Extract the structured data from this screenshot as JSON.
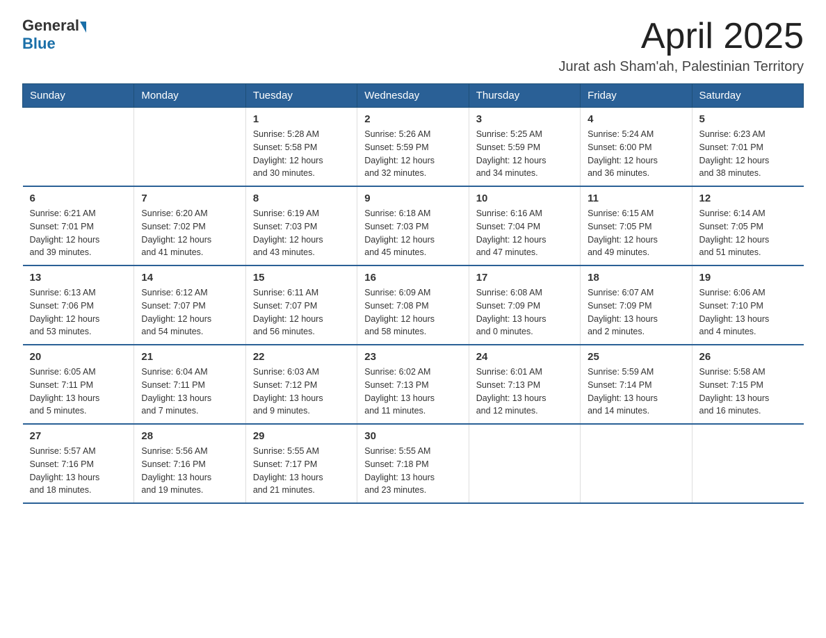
{
  "logo": {
    "general": "General",
    "blue": "Blue"
  },
  "header": {
    "month": "April 2025",
    "location": "Jurat ash Sham'ah, Palestinian Territory"
  },
  "weekdays": [
    "Sunday",
    "Monday",
    "Tuesday",
    "Wednesday",
    "Thursday",
    "Friday",
    "Saturday"
  ],
  "weeks": [
    [
      {
        "day": "",
        "info": ""
      },
      {
        "day": "",
        "info": ""
      },
      {
        "day": "1",
        "info": "Sunrise: 5:28 AM\nSunset: 5:58 PM\nDaylight: 12 hours\nand 30 minutes."
      },
      {
        "day": "2",
        "info": "Sunrise: 5:26 AM\nSunset: 5:59 PM\nDaylight: 12 hours\nand 32 minutes."
      },
      {
        "day": "3",
        "info": "Sunrise: 5:25 AM\nSunset: 5:59 PM\nDaylight: 12 hours\nand 34 minutes."
      },
      {
        "day": "4",
        "info": "Sunrise: 5:24 AM\nSunset: 6:00 PM\nDaylight: 12 hours\nand 36 minutes."
      },
      {
        "day": "5",
        "info": "Sunrise: 6:23 AM\nSunset: 7:01 PM\nDaylight: 12 hours\nand 38 minutes."
      }
    ],
    [
      {
        "day": "6",
        "info": "Sunrise: 6:21 AM\nSunset: 7:01 PM\nDaylight: 12 hours\nand 39 minutes."
      },
      {
        "day": "7",
        "info": "Sunrise: 6:20 AM\nSunset: 7:02 PM\nDaylight: 12 hours\nand 41 minutes."
      },
      {
        "day": "8",
        "info": "Sunrise: 6:19 AM\nSunset: 7:03 PM\nDaylight: 12 hours\nand 43 minutes."
      },
      {
        "day": "9",
        "info": "Sunrise: 6:18 AM\nSunset: 7:03 PM\nDaylight: 12 hours\nand 45 minutes."
      },
      {
        "day": "10",
        "info": "Sunrise: 6:16 AM\nSunset: 7:04 PM\nDaylight: 12 hours\nand 47 minutes."
      },
      {
        "day": "11",
        "info": "Sunrise: 6:15 AM\nSunset: 7:05 PM\nDaylight: 12 hours\nand 49 minutes."
      },
      {
        "day": "12",
        "info": "Sunrise: 6:14 AM\nSunset: 7:05 PM\nDaylight: 12 hours\nand 51 minutes."
      }
    ],
    [
      {
        "day": "13",
        "info": "Sunrise: 6:13 AM\nSunset: 7:06 PM\nDaylight: 12 hours\nand 53 minutes."
      },
      {
        "day": "14",
        "info": "Sunrise: 6:12 AM\nSunset: 7:07 PM\nDaylight: 12 hours\nand 54 minutes."
      },
      {
        "day": "15",
        "info": "Sunrise: 6:11 AM\nSunset: 7:07 PM\nDaylight: 12 hours\nand 56 minutes."
      },
      {
        "day": "16",
        "info": "Sunrise: 6:09 AM\nSunset: 7:08 PM\nDaylight: 12 hours\nand 58 minutes."
      },
      {
        "day": "17",
        "info": "Sunrise: 6:08 AM\nSunset: 7:09 PM\nDaylight: 13 hours\nand 0 minutes."
      },
      {
        "day": "18",
        "info": "Sunrise: 6:07 AM\nSunset: 7:09 PM\nDaylight: 13 hours\nand 2 minutes."
      },
      {
        "day": "19",
        "info": "Sunrise: 6:06 AM\nSunset: 7:10 PM\nDaylight: 13 hours\nand 4 minutes."
      }
    ],
    [
      {
        "day": "20",
        "info": "Sunrise: 6:05 AM\nSunset: 7:11 PM\nDaylight: 13 hours\nand 5 minutes."
      },
      {
        "day": "21",
        "info": "Sunrise: 6:04 AM\nSunset: 7:11 PM\nDaylight: 13 hours\nand 7 minutes."
      },
      {
        "day": "22",
        "info": "Sunrise: 6:03 AM\nSunset: 7:12 PM\nDaylight: 13 hours\nand 9 minutes."
      },
      {
        "day": "23",
        "info": "Sunrise: 6:02 AM\nSunset: 7:13 PM\nDaylight: 13 hours\nand 11 minutes."
      },
      {
        "day": "24",
        "info": "Sunrise: 6:01 AM\nSunset: 7:13 PM\nDaylight: 13 hours\nand 12 minutes."
      },
      {
        "day": "25",
        "info": "Sunrise: 5:59 AM\nSunset: 7:14 PM\nDaylight: 13 hours\nand 14 minutes."
      },
      {
        "day": "26",
        "info": "Sunrise: 5:58 AM\nSunset: 7:15 PM\nDaylight: 13 hours\nand 16 minutes."
      }
    ],
    [
      {
        "day": "27",
        "info": "Sunrise: 5:57 AM\nSunset: 7:16 PM\nDaylight: 13 hours\nand 18 minutes."
      },
      {
        "day": "28",
        "info": "Sunrise: 5:56 AM\nSunset: 7:16 PM\nDaylight: 13 hours\nand 19 minutes."
      },
      {
        "day": "29",
        "info": "Sunrise: 5:55 AM\nSunset: 7:17 PM\nDaylight: 13 hours\nand 21 minutes."
      },
      {
        "day": "30",
        "info": "Sunrise: 5:55 AM\nSunset: 7:18 PM\nDaylight: 13 hours\nand 23 minutes."
      },
      {
        "day": "",
        "info": ""
      },
      {
        "day": "",
        "info": ""
      },
      {
        "day": "",
        "info": ""
      }
    ]
  ]
}
